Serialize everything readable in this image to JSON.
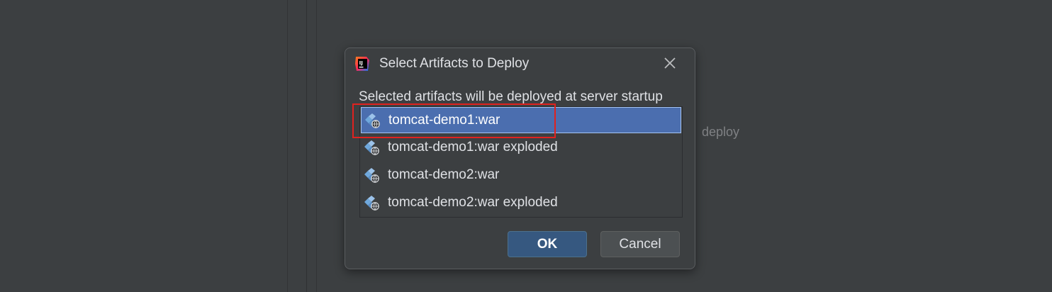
{
  "background": {
    "hint_text": "deploy"
  },
  "dialog": {
    "title": "Select Artifacts to Deploy",
    "app_icon": "intellij-idea-icon",
    "close_icon": "close-icon",
    "description": "Selected artifacts will be deployed at server startup",
    "artifacts": [
      {
        "label": "tomcat-demo1:war",
        "icon": "web-artifact-icon",
        "selected": true
      },
      {
        "label": "tomcat-demo1:war exploded",
        "icon": "web-artifact-icon",
        "selected": false
      },
      {
        "label": "tomcat-demo2:war",
        "icon": "web-artifact-icon",
        "selected": false
      },
      {
        "label": "tomcat-demo2:war exploded",
        "icon": "web-artifact-icon",
        "selected": false
      }
    ],
    "ok_label": "OK",
    "cancel_label": "Cancel"
  },
  "colors": {
    "selection": "#4b6eaf",
    "ok_button": "#365880",
    "highlight_annotation": "#e0221f"
  }
}
